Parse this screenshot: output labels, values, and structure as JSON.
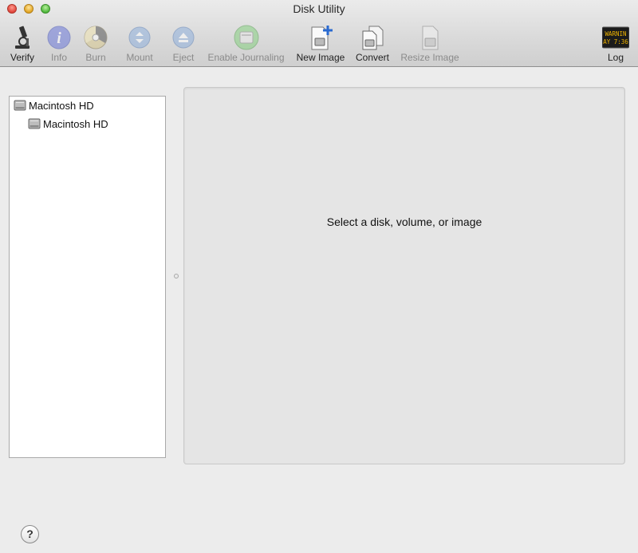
{
  "window": {
    "title": "Disk Utility"
  },
  "toolbar": {
    "items": [
      {
        "label": "Verify",
        "icon": "microscope-icon",
        "enabled": true
      },
      {
        "label": "Info",
        "icon": "info-icon",
        "enabled": false
      },
      {
        "label": "Burn",
        "icon": "burn-icon",
        "enabled": false
      },
      {
        "label": "Mount",
        "icon": "mount-icon",
        "enabled": false
      },
      {
        "label": "Eject",
        "icon": "eject-icon",
        "enabled": false
      },
      {
        "label": "Enable Journaling",
        "icon": "journaling-icon",
        "enabled": false
      },
      {
        "label": "New Image",
        "icon": "new-image-icon",
        "enabled": true
      },
      {
        "label": "Convert",
        "icon": "convert-icon",
        "enabled": true
      },
      {
        "label": "Resize Image",
        "icon": "resize-image-icon",
        "enabled": false
      },
      {
        "label": "Log",
        "icon": "log-icon",
        "enabled": true
      }
    ],
    "log_icon_text": {
      "line1": "WARNIN",
      "line2": "AY 7:36"
    }
  },
  "sidebar": {
    "items": [
      {
        "label": "Macintosh HD",
        "icon": "hard-disk-icon",
        "level": 0
      },
      {
        "label": "Macintosh HD",
        "icon": "volume-icon",
        "level": 1
      }
    ]
  },
  "main": {
    "placeholder": "Select a disk, volume, or image"
  },
  "help": {
    "label": "?"
  },
  "colors": {
    "window_bg": "#ececec",
    "content_bg": "#e5e5e5",
    "sidebar_bg": "#ffffff"
  }
}
